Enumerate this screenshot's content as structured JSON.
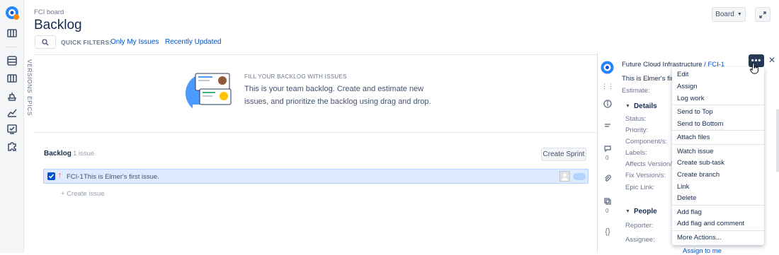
{
  "header": {
    "breadcrumb": "FCI board",
    "title": "Backlog",
    "board_button": "Board",
    "quick_filters_label": "QUICK FILTERS:",
    "filters": [
      "Only My Issues",
      "Recently Updated"
    ]
  },
  "side_tabs": {
    "versions": "VERSIONS",
    "epics": "EPICS"
  },
  "empty_state": {
    "heading": "FILL YOUR BACKLOG WITH ISSUES",
    "text": "This is your team backlog. Create and estimate new issues, and prioritize the backlog using drag and drop."
  },
  "backlog": {
    "label": "Backlog",
    "count": "1 issue",
    "create_sprint": "Create Sprint",
    "issue": {
      "key": "FCI-1",
      "summary": "This is Elmer's first issue."
    },
    "create_issue": "+ Create issue"
  },
  "detail": {
    "project": "Future Cloud Infrastructure",
    "separator": "/",
    "issue_key": "FCI-1",
    "summary_truncated": "This is Elmer's first",
    "estimate_label": "Estimate:",
    "details_heading": "Details",
    "fields": [
      "Status:",
      "Priority:",
      "Component/s:",
      "Labels:",
      "Affects Version/s:",
      "Fix Version/s:",
      "Epic Link:"
    ],
    "comments_count": "0",
    "subtasks_count": "0",
    "people_heading": "People",
    "people_fields": [
      "Reporter:",
      "Assignee:"
    ],
    "assign_to_me": "Assign to me"
  },
  "menu": {
    "items": [
      "Edit",
      "Assign",
      "Log work",
      "Send to Top",
      "Send to Bottom",
      "Attach files",
      "Watch issue",
      "Create sub-task",
      "Create branch",
      "Link",
      "Delete",
      "Add flag",
      "Add flag and comment",
      "More Actions..."
    ]
  },
  "colors": {
    "brand_blue": "#0052cc",
    "selection": "#deebff",
    "more_button": "#253858"
  }
}
